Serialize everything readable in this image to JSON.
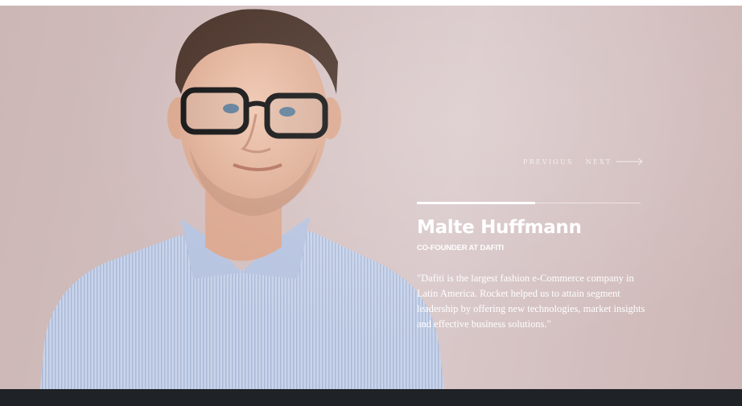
{
  "testimonial": {
    "nav": {
      "previous_label": "PREVIOUS",
      "next_label": "NEXT"
    },
    "name": "Malte Huffmann",
    "role": "CO-FOUNDER AT DAFITI",
    "quote": "\"Dafiti is the largest fashion e-Commerce company in Latin America. Rocket helped us to attain segment leadership by offering new technologies, market insights and effective business solutions.\"",
    "slide_progress": 0.53
  },
  "colors": {
    "hero_background": "#d4c0c0",
    "text": "#ffffff",
    "footer": "#1f2226"
  },
  "icons": [
    "arrow-right-icon"
  ]
}
